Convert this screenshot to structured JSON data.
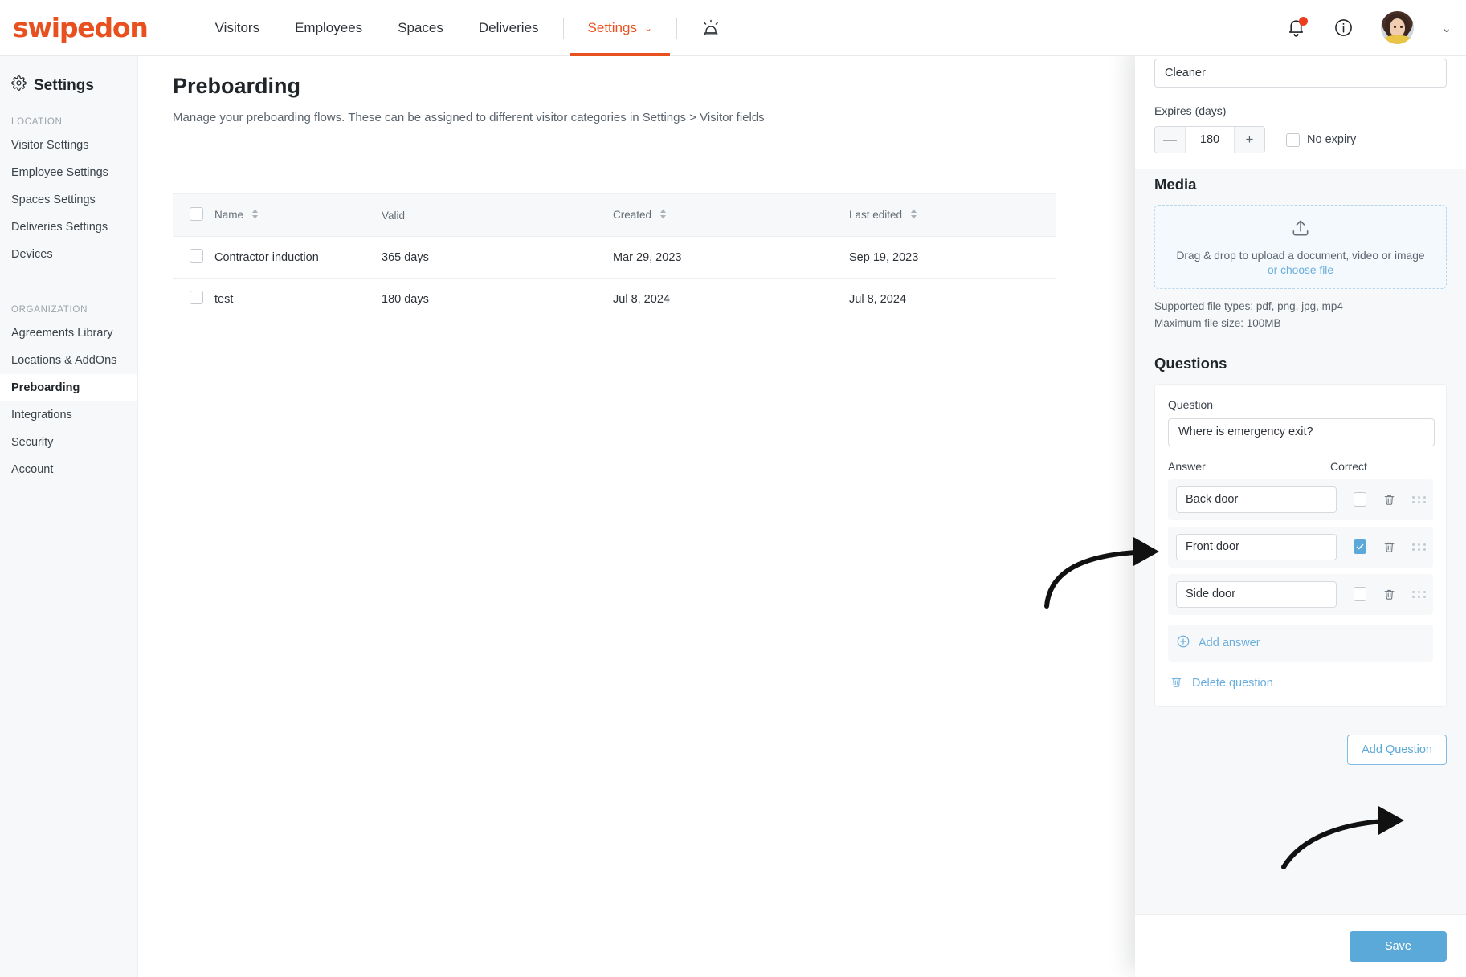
{
  "topnav": {
    "brand": "swipedon",
    "items": [
      {
        "label": "Visitors"
      },
      {
        "label": "Employees"
      },
      {
        "label": "Spaces"
      },
      {
        "label": "Deliveries"
      },
      {
        "label": "Settings",
        "active": true
      }
    ],
    "settings_chevron": "⌄",
    "icons": {
      "siren": "siren-icon",
      "bell": "bell-icon",
      "info": "info-icon",
      "avatar": "avatar",
      "account_chevron": "⌄"
    },
    "notification_dot_color": "#ec3d1e",
    "accent_color": "#e8501f"
  },
  "sidebar": {
    "title": "Settings",
    "groups": [
      {
        "label": "LOCATION",
        "items": [
          {
            "label": "Visitor Settings"
          },
          {
            "label": "Employee Settings"
          },
          {
            "label": "Spaces Settings"
          },
          {
            "label": "Deliveries Settings"
          },
          {
            "label": "Devices"
          }
        ]
      },
      {
        "label": "ORGANIZATION",
        "items": [
          {
            "label": "Agreements Library"
          },
          {
            "label": "Locations & AddOns"
          },
          {
            "label": "Preboarding",
            "active": true
          },
          {
            "label": "Integrations"
          },
          {
            "label": "Security"
          },
          {
            "label": "Account"
          }
        ]
      }
    ]
  },
  "main": {
    "title": "Preboarding",
    "subtitle": "Manage your preboarding flows. These can be assigned to different visitor categories in Settings > Visitor fields",
    "table": {
      "columns": [
        {
          "label": "Name",
          "sortable": true
        },
        {
          "label": "Valid",
          "sortable": false
        },
        {
          "label": "Created",
          "sortable": true
        },
        {
          "label": "Last edited",
          "sortable": true
        }
      ],
      "rows": [
        {
          "name": "Contractor induction",
          "valid": "365 days",
          "created": "Mar 29, 2023",
          "last_edited": "Sep 19, 2023"
        },
        {
          "name": "test",
          "valid": "180 days",
          "created": "Jul 8, 2024",
          "last_edited": "Jul 8, 2024"
        }
      ]
    }
  },
  "panel": {
    "name_value": "Cleaner",
    "expires_label": "Expires (days)",
    "expires_value": "180",
    "stepper_minus": "—",
    "stepper_plus": "+",
    "no_expiry_label": "No expiry",
    "media": {
      "title": "Media",
      "dropzone_text": "Drag & drop to upload a document, video or image",
      "dropzone_link": "or choose file",
      "supported": "Supported file types: pdf, png, jpg, mp4",
      "max_size": "Maximum file size: 100MB"
    },
    "questions": {
      "title": "Questions",
      "question_label": "Question",
      "question_value": "Where is emergency exit?",
      "answer_label": "Answer",
      "correct_label": "Correct",
      "answers": [
        {
          "value": "Back door",
          "correct": false
        },
        {
          "value": "Front door",
          "correct": true
        },
        {
          "value": "Side door",
          "correct": false
        }
      ],
      "add_answer_label": "Add answer",
      "delete_question_label": "Delete question",
      "add_question_label": "Add Question"
    },
    "save_label": "Save",
    "accent_blue": "#5ba9d8"
  }
}
